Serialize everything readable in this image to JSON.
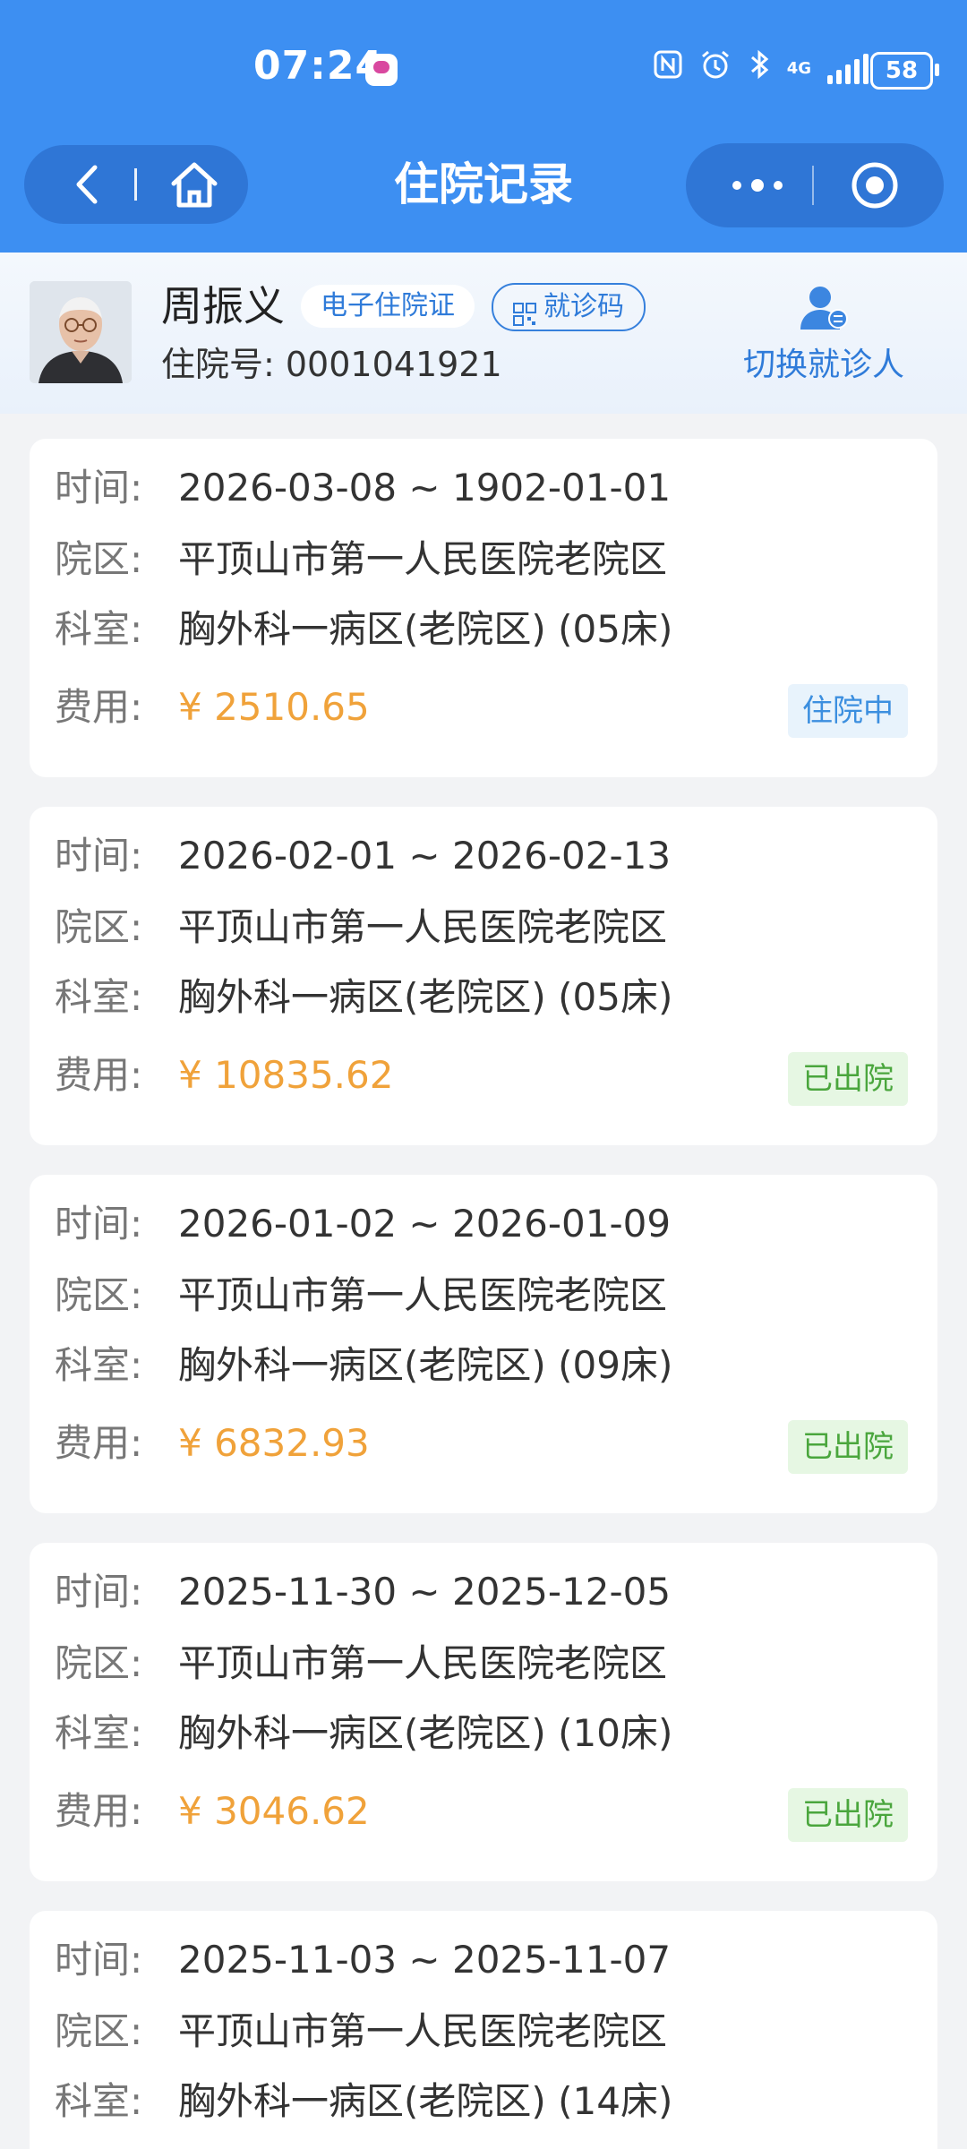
{
  "status_bar": {
    "time": "07:24",
    "battery": "58",
    "network": "4G"
  },
  "nav": {
    "title": "住院记录",
    "icons": [
      "back-icon",
      "home-icon",
      "more-icon",
      "target-icon"
    ]
  },
  "patient": {
    "name": "周振义",
    "tag_card": "电子住院证",
    "tag_code": "就诊码",
    "admission_no": "住院号: 0001041921",
    "switch_label": "切换就诊人"
  },
  "labels": {
    "time": "时间:",
    "campus": "院区:",
    "dept": "科室:",
    "fee": "费用:"
  },
  "records": [
    {
      "time": "2026-03-08 ~ 1902-01-01",
      "campus": "平顶山市第一人民医院老院区",
      "dept": "胸外科一病区(老院区) (05床)",
      "fee": "¥ 2510.65",
      "status": "住院中"
    },
    {
      "time": "2026-02-01 ~ 2026-02-13",
      "campus": "平顶山市第一人民医院老院区",
      "dept": "胸外科一病区(老院区) (05床)",
      "fee": "¥ 10835.62",
      "status": "已出院"
    },
    {
      "time": "2026-01-02 ~ 2026-01-09",
      "campus": "平顶山市第一人民医院老院区",
      "dept": "胸外科一病区(老院区) (09床)",
      "fee": "¥ 6832.93",
      "status": "已出院"
    },
    {
      "time": "2025-11-30 ~ 2025-12-05",
      "campus": "平顶山市第一人民医院老院区",
      "dept": "胸外科一病区(老院区) (10床)",
      "fee": "¥ 3046.62",
      "status": "已出院"
    },
    {
      "time": "2025-11-03 ~ 2025-11-07",
      "campus": "平顶山市第一人民医院老院区",
      "dept": "胸外科一病区(老院区) (14床)",
      "fee": "",
      "status": ""
    }
  ],
  "colors": {
    "header_blue": "#3d8ff2",
    "fee_orange": "#f0a23a",
    "in_hospital_blue": "#3c8fdf",
    "discharged_green": "#4aa63d"
  }
}
